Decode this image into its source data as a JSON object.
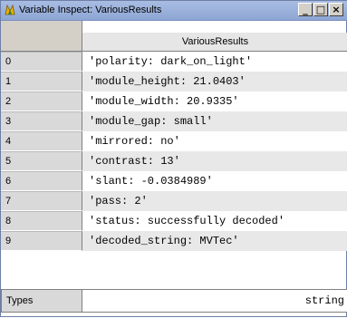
{
  "window": {
    "title": "Variable Inspect: VariousResults",
    "icon": "halcon-app-icon",
    "buttons": {
      "minimize": "_",
      "maximize": "□",
      "close": "×"
    }
  },
  "table": {
    "column_header": "VariousResults",
    "rows": [
      {
        "index": "0",
        "value": "'polarity: dark_on_light'"
      },
      {
        "index": "1",
        "value": "'module_height: 21.0403'"
      },
      {
        "index": "2",
        "value": "'module_width: 20.9335'"
      },
      {
        "index": "3",
        "value": "'module_gap: small'"
      },
      {
        "index": "4",
        "value": "'mirrored: no'"
      },
      {
        "index": "5",
        "value": "'contrast: 13'"
      },
      {
        "index": "6",
        "value": "'slant: -0.0384989'"
      },
      {
        "index": "7",
        "value": "'pass: 2'"
      },
      {
        "index": "8",
        "value": "'status: successfully decoded'"
      },
      {
        "index": "9",
        "value": "'decoded_string: MVTec'"
      }
    ],
    "footer": {
      "label": "Types",
      "value": "string"
    }
  }
}
